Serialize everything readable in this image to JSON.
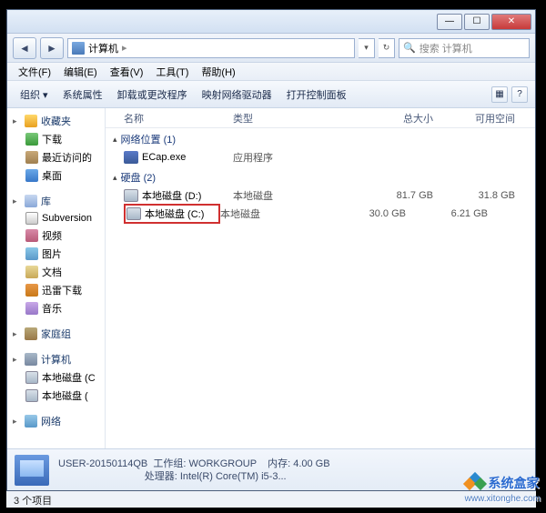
{
  "titlebar": {
    "min": "—",
    "max": "☐",
    "close": "✕"
  },
  "nav": {
    "back": "◄",
    "fwd": "►",
    "path_icon": "computer-icon",
    "path_label": "计算机",
    "sep": "▸",
    "drop": "▾",
    "refresh": "↻",
    "search_placeholder": "搜索 计算机",
    "search_icon": "🔍"
  },
  "menu": {
    "file": "文件(F)",
    "edit": "编辑(E)",
    "view": "查看(V)",
    "tools": "工具(T)",
    "help": "帮助(H)"
  },
  "toolbar": {
    "org": "组织 ▾",
    "props": "系统属性",
    "uninstall": "卸载或更改程序",
    "netdrv": "映射网络驱动器",
    "cp": "打开控制面板",
    "view_icon": "▦",
    "help_icon": "?"
  },
  "columns": {
    "name": "名称",
    "type": "类型",
    "total": "总大小",
    "free": "可用空间"
  },
  "sidebar": {
    "fav": "收藏夹",
    "dl": "下载",
    "recent": "最近访问的",
    "desk": "桌面",
    "lib": "库",
    "svn": "Subversion",
    "vid": "视频",
    "pic": "图片",
    "doc": "文档",
    "xdl": "迅雷下载",
    "mus": "音乐",
    "home": "家庭组",
    "comp": "计算机",
    "drive_c": "本地磁盘 (C",
    "drive_d": "本地磁盘 (",
    "net": "网络"
  },
  "groups": {
    "netloc": {
      "label": "网络位置 (1)"
    },
    "disk": {
      "label": "硬盘 (2)"
    }
  },
  "items": {
    "ecap": {
      "name": "ECap.exe",
      "type": "应用程序"
    },
    "d": {
      "name": "本地磁盘 (D:)",
      "type": "本地磁盘",
      "total": "81.7 GB",
      "free": "31.8 GB"
    },
    "c": {
      "name": "本地磁盘 (C:)",
      "type": "本地磁盘",
      "total": "30.0 GB",
      "free": "6.21 GB"
    }
  },
  "details": {
    "name": "USER-20150114QB",
    "workgroup_label": "工作组:",
    "workgroup": "WORKGROUP",
    "mem_label": "内存:",
    "mem": "4.00 GB",
    "cpu_label": "处理器:",
    "cpu": "Intel(R) Core(TM) i5-3..."
  },
  "status": {
    "count": "3 个项目"
  },
  "watermark": {
    "text": "系统盒家",
    "url": "www.xitonghe.com"
  }
}
